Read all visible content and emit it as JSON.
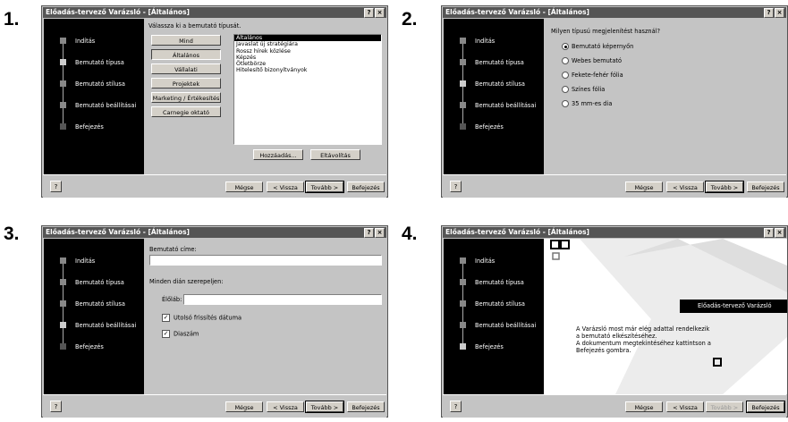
{
  "panel_numbers": [
    "1.",
    "2.",
    "3.",
    "4."
  ],
  "window_title": "Előadás-tervező Varázsló - [Általános]",
  "titlebar_buttons": {
    "help": "?",
    "close": "×"
  },
  "steps": [
    "Indítás",
    "Bemutató típusa",
    "Bemutató stílusa",
    "Bemutató beállításai",
    "Befejezés"
  ],
  "footer": {
    "help": "?",
    "cancel": "Mégse",
    "back": "< Vissza",
    "next": "Tovább >",
    "finish": "Befejezés"
  },
  "panel1": {
    "prompt": "Válassza ki a bemutató típusát.",
    "category_buttons": [
      "Mind",
      "Általános",
      "Vállalati",
      "Projektek",
      "Marketing / Értékesítés",
      "Carnegie oktató"
    ],
    "types": [
      "Általános",
      "Javaslat új stratégiára",
      "Rossz hírek közlése",
      "Képzés",
      "Ötletbörze",
      "Hitelesítő bizonyítványok"
    ],
    "add_button": "Hozzáadás...",
    "remove_button": "Eltávolítás"
  },
  "panel2": {
    "question": "Milyen típusú megjelenítést használ?",
    "options": [
      "Bemutató képernyőn",
      "Webes bemutató",
      "Fekete-fehér fólia",
      "Színes fólia",
      "35 mm-es dia"
    ],
    "selected": 0
  },
  "panel3": {
    "title_label": "Bemutató címe:",
    "title_value": "",
    "repeat_label": "Minden dián szerepeljen:",
    "footer_label": "Élőláb:",
    "footer_value": "",
    "checkbox_date": "Utolsó frissítés dátuma",
    "checkbox_slide_number": "Diaszám",
    "check_mark": "✓"
  },
  "panel4": {
    "wizard_name": "Előadás-tervező Varázsló",
    "message": [
      "A Varázsló most már elég adattal rendelkezik",
      "a bemutató elkészítéséhez.",
      "A dokumentum megtekintéséhez kattintson a",
      "Befejezés gombra."
    ]
  }
}
